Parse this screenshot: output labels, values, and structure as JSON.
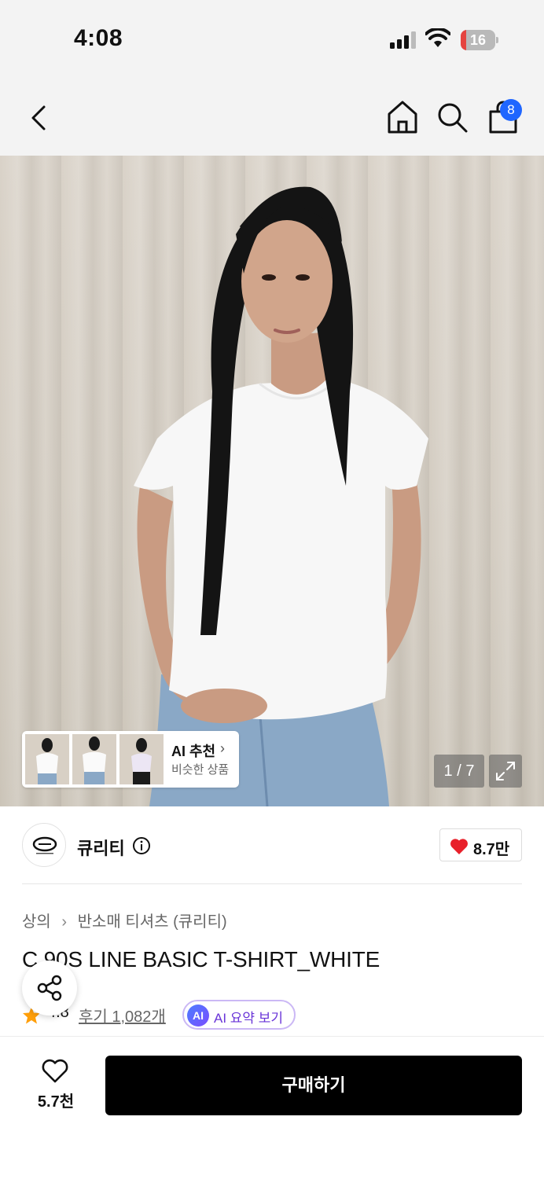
{
  "status_bar": {
    "time": "4:08",
    "battery": "16",
    "battery_level": 0.16
  },
  "nav": {
    "back_icon": "chevron-left-icon",
    "home_icon": "home-icon",
    "search_icon": "search-icon",
    "cart_icon": "shopping-bag-icon",
    "cart_count": "8"
  },
  "hero": {
    "ai_recommend": {
      "title": "AI 추천",
      "subtitle": "비슷한 상품"
    },
    "counter": "1 / 7",
    "expand_icon": "expand-icon"
  },
  "brand": {
    "name": "큐리티",
    "info_icon": "info-icon",
    "likes": "8.7만"
  },
  "product": {
    "breadcrumb": [
      "상의",
      "반소매 티셔츠 (큐리티)"
    ],
    "title": "C 90S LINE BASIC T-SHIRT_WHITE",
    "rating": "4.8",
    "reviews": "후기 1,082개",
    "ai_badge": "AI",
    "ai_summary": "AI 요약 보기"
  },
  "bottom": {
    "wish_count": "5.7천",
    "buy_label": "구매하기"
  },
  "colors": {
    "accent_blue": "#1f66ff",
    "heart_red": "#e8202a",
    "star_orange": "#ff9f0a",
    "ai_purple": "#6a35d8",
    "buy_black": "#000000"
  }
}
